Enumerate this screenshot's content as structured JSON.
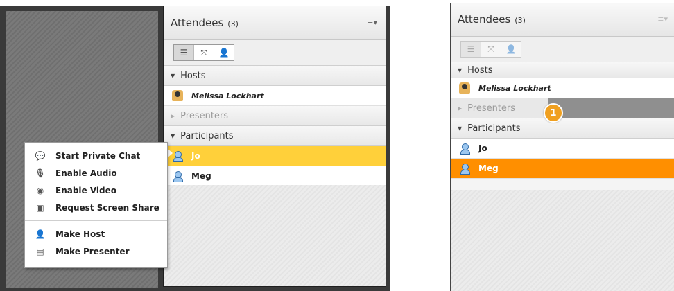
{
  "left_panel": {
    "title": "Attendees",
    "count": "(3)",
    "menu_icon": "menu-dropdown-icon",
    "sections": {
      "hosts": "Hosts",
      "presenters": "Presenters",
      "participants": "Participants"
    },
    "hosts": [
      {
        "name": "Melissa Lockhart"
      }
    ],
    "participants": [
      {
        "name": "Jo"
      },
      {
        "name": "Meg"
      }
    ]
  },
  "context_menu": {
    "items": [
      {
        "label": "Start Private Chat",
        "icon": "chat-icon"
      },
      {
        "label": "Enable Audio",
        "icon": "microphone-icon"
      },
      {
        "label": "Enable Video",
        "icon": "webcam-icon"
      },
      {
        "label": "Request Screen Share",
        "icon": "screen-share-icon"
      }
    ],
    "items2": [
      {
        "label": "Make Host",
        "icon": "host-icon"
      },
      {
        "label": "Make Presenter",
        "icon": "presenter-icon"
      }
    ]
  },
  "right_panel": {
    "title": "Attendees",
    "count": "(3)",
    "sections": {
      "hosts": "Hosts",
      "presenters": "Presenters",
      "participants": "Participants"
    },
    "hosts": [
      {
        "name": "Melissa Lockhart"
      }
    ],
    "participants": [
      {
        "name": "Jo"
      },
      {
        "name": "Meg"
      }
    ],
    "callout": "1"
  },
  "colors": {
    "selected_yellow": "#ffd03a",
    "selected_orange": "#ff8f00",
    "callout": "#f0a020"
  }
}
